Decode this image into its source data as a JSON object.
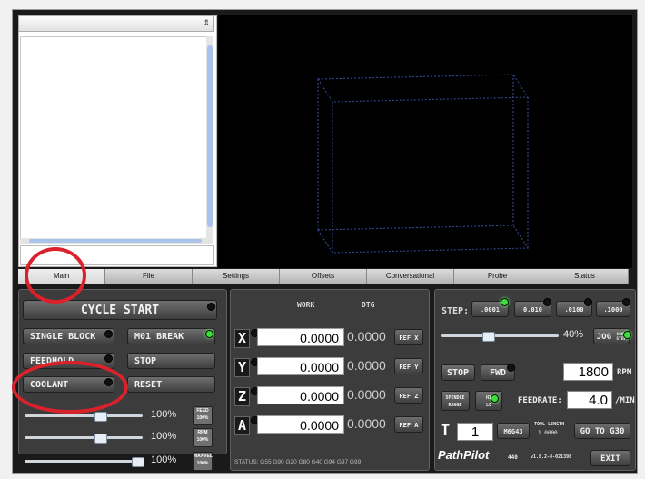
{
  "tabs": [
    "Main",
    "File",
    "Settings",
    "Offsets",
    "Conversational",
    "Probe",
    "Status"
  ],
  "left": {
    "cycle_start": "CYCLE START",
    "single_block": "SINGLE BLOCK",
    "m01_break": "M01 BREAK",
    "feedhold": "FEEDHOLD",
    "stop": "STOP",
    "coolant": "COOLANT",
    "reset": "RESET",
    "overrides": [
      {
        "pct": "100%",
        "badge": [
          "FEED",
          "100%"
        ],
        "value": 100
      },
      {
        "pct": "100%",
        "badge": [
          "RPM",
          "100%"
        ],
        "value": 100
      },
      {
        "pct": "100%",
        "badge": [
          "MAXVEL",
          "100%"
        ],
        "value": 100
      }
    ]
  },
  "dro": {
    "work_label": "WORK",
    "dtg_label": "DTG",
    "axes": [
      {
        "axis": "X",
        "work": "0.0000",
        "dtg": "0.0000",
        "ref": "REF X"
      },
      {
        "axis": "Y",
        "work": "0.0000",
        "dtg": "0.0000",
        "ref": "REF Y"
      },
      {
        "axis": "Z",
        "work": "0.0000",
        "dtg": "0.0000",
        "ref": "REF Z"
      },
      {
        "axis": "A",
        "work": "0.0000",
        "dtg": "0.0000",
        "ref": "REF A"
      }
    ],
    "status": "STATUS: G55 G90 G20 G80 G40 G94 G97 G99"
  },
  "right": {
    "step_label": "STEP:",
    "steps": [
      ".0001",
      "0.010",
      ".0100",
      ".1000"
    ],
    "jog_pct": "40%",
    "jog_value": 40,
    "jog_label": "JOG",
    "jog_mode": [
      "CONT",
      "STEP"
    ],
    "spindle_stop": "STOP",
    "spindle_fwd": "FWD",
    "rpm": "1800",
    "rpm_unit": "RPM",
    "spindle_range_label": [
      "SPINDLE",
      "RANGE"
    ],
    "range_value": [
      "HI",
      "LO"
    ],
    "feedrate_label": "FEEDRATE:",
    "feedrate": "4.0",
    "feed_unit": "/MIN",
    "tool_label": "T",
    "tool_number": "1",
    "m6g43": "M6G43",
    "tool_length_label": "TOOL LENGTH",
    "tool_length": "1.0000",
    "goto_g30": "GO TO G30",
    "logo": "PathPilot",
    "version_a": "440",
    "version_b": "v1.8.2-8-021398",
    "exit": "EXIT"
  },
  "colors": {
    "panel": "#3c3c3c",
    "led_on": "#38e038",
    "highlight_circle": "#d9222c",
    "preview_box": "#3a4fa0"
  }
}
